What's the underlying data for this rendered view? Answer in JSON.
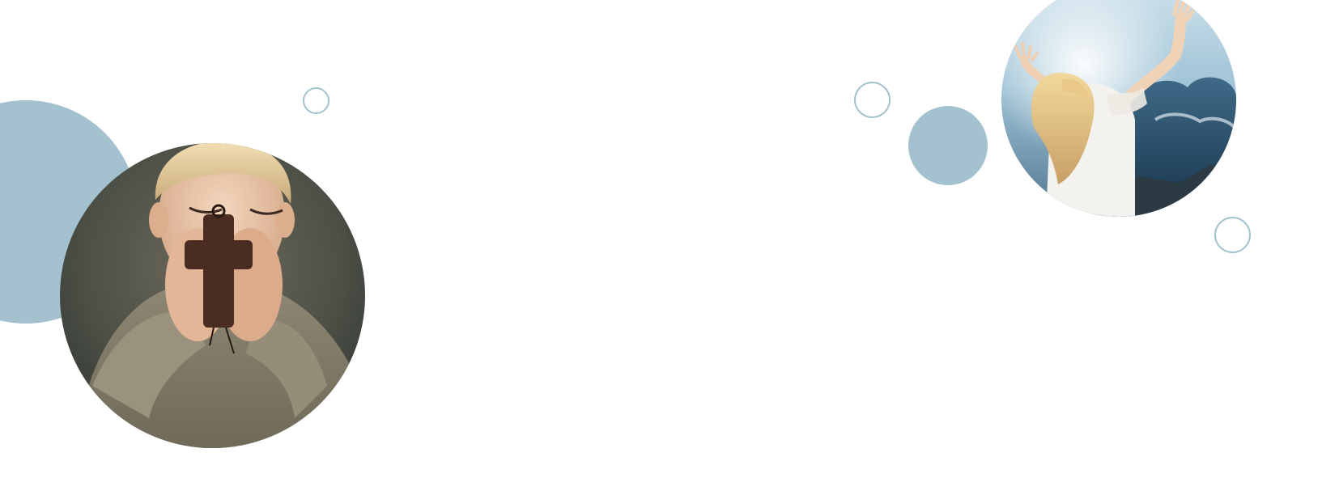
{
  "colors": {
    "background": "#ffffff",
    "accent_fill": "#a3c1ce",
    "accent_ring": "#a3c2cf"
  },
  "photos": [
    {
      "subject": "child-praying-with-cross"
    },
    {
      "subject": "woman-raising-hands-to-sky"
    }
  ]
}
